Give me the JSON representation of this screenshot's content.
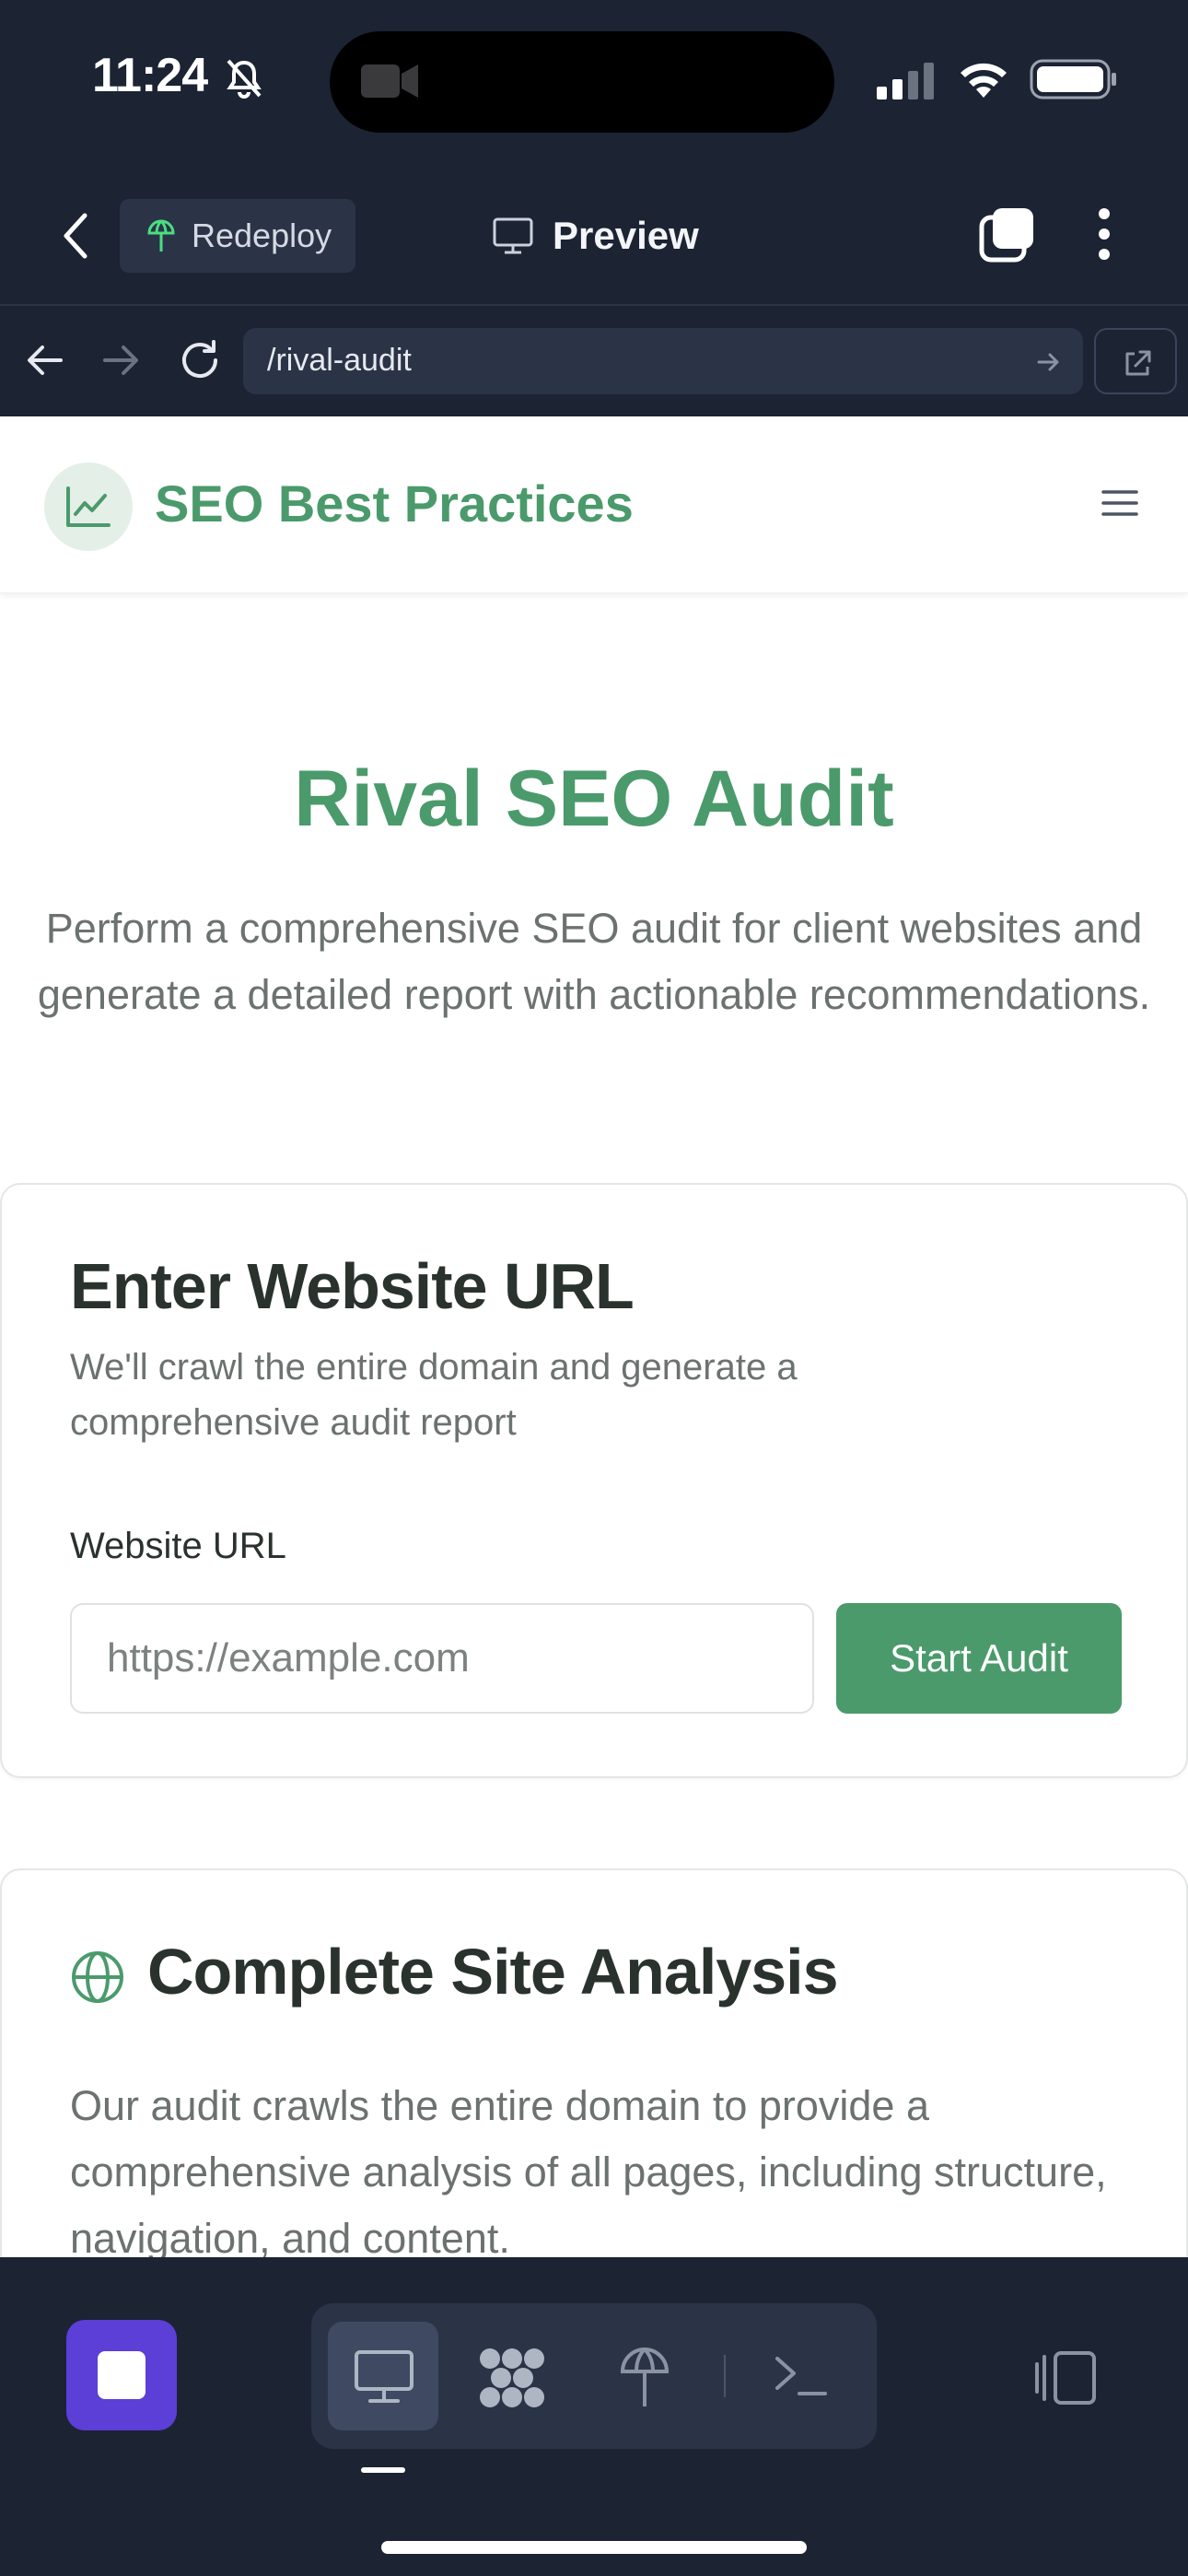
{
  "status_bar": {
    "time": "11:24"
  },
  "app_header": {
    "redeploy_label": "Redeploy",
    "title": "Preview"
  },
  "browser": {
    "url": "/rival-audit"
  },
  "site": {
    "brand": "SEO Best Practices",
    "hero": {
      "title": "Rival SEO Audit",
      "description": "Perform a comprehensive SEO audit for client websites and generate a detailed report with actionable recommendations."
    },
    "audit_card": {
      "title": "Enter Website URL",
      "subtitle": "We'll crawl the entire domain and generate a comprehensive audit report",
      "field_label": "Website URL",
      "input_value": "",
      "input_placeholder": "https://example.com",
      "submit_label": "Start Audit"
    },
    "analysis_card": {
      "title": "Complete Site Analysis",
      "body": "Our audit crawls the entire domain to provide a comprehensive analysis of all pages, including structure, navigation, and content."
    }
  },
  "colors": {
    "brand_green": "#4b9a6c",
    "chrome_bg": "#1c2333",
    "stop_purple": "#5b3fd6"
  },
  "icons": [
    "bell-slash-icon",
    "camera-icon",
    "signal-icon",
    "wifi-icon",
    "battery-icon",
    "back-icon",
    "redeploy-icon",
    "monitor-icon",
    "tabs-icon",
    "more-icon",
    "arrow-left-icon",
    "arrow-right-icon",
    "reload-icon",
    "arrow-go-icon",
    "external-link-icon",
    "chart-line-icon",
    "hamburger-icon",
    "globe-icon",
    "stop-icon",
    "desktop-icon",
    "apps-icon",
    "deploy-icon",
    "terminal-icon",
    "device-switch-icon"
  ]
}
